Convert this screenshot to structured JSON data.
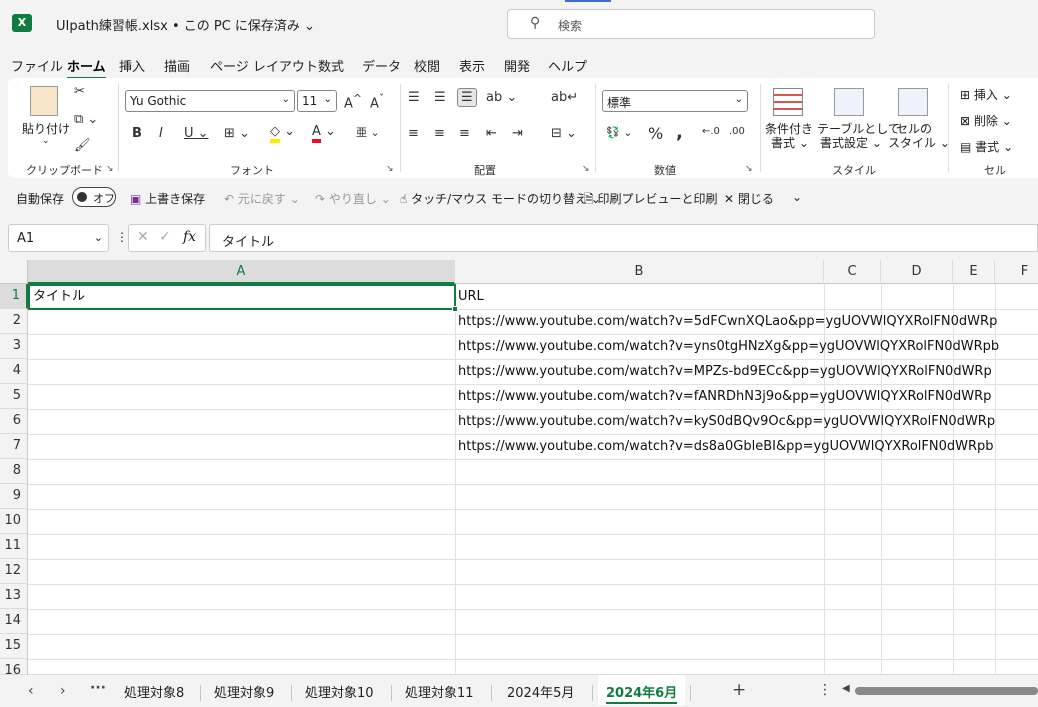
{
  "window": {
    "doc_title": "UIpath練習帳.xlsx • この PC に保存済み",
    "search_placeholder": "検索"
  },
  "menu": [
    "ファイル",
    "ホーム",
    "挿入",
    "描画",
    "ページ レイアウト",
    "数式",
    "データ",
    "校閲",
    "表示",
    "開発",
    "ヘルプ"
  ],
  "ribbon": {
    "clipboard": {
      "paste": "貼り付け",
      "label": "クリップボード"
    },
    "font": {
      "family": "Yu Gothic",
      "size": "11",
      "label": "フォント"
    },
    "alignment": {
      "label": "配置"
    },
    "number": {
      "format": "標準",
      "label": "数値"
    },
    "styles": {
      "conditional": "条件付き",
      "conditional2": "書式",
      "table": "テーブルとして",
      "table2": "書式設定",
      "cell": "セルの",
      "cell2": "スタイル",
      "label": "スタイル"
    },
    "cells": {
      "insert": "挿入",
      "delete": "削除",
      "format": "書式",
      "label": "セル"
    }
  },
  "qat": {
    "autosave": "自動保存",
    "autosave_state": "オフ",
    "save": "上書き保存",
    "undo": "元に戻す",
    "redo": "やり直し",
    "touch": "タッチ/マウス モードの切り替え",
    "print": "印刷プレビューと印刷",
    "close": "閉じる"
  },
  "formula_bar": {
    "name_box": "A1",
    "content": "タイトル"
  },
  "columns": [
    "A",
    "B",
    "C",
    "D",
    "E",
    "F"
  ],
  "rows": [
    "1",
    "2",
    "3",
    "4",
    "5",
    "6",
    "7",
    "8",
    "9",
    "10",
    "11",
    "12",
    "13",
    "14",
    "15",
    "16"
  ],
  "cells": {
    "A1": "タイトル",
    "B1": "URL",
    "B2": "https://www.youtube.com/watch?v=5dFCwnXQLao&pp=ygUOVWlQYXRolFN0dWRp",
    "B3": "https://www.youtube.com/watch?v=yns0tgHNzXg&pp=ygUOVWlQYXRolFN0dWRpb",
    "B4": "https://www.youtube.com/watch?v=MPZs-bd9ECc&pp=ygUOVWlQYXRolFN0dWRp",
    "B5": "https://www.youtube.com/watch?v=fANRDhN3j9o&pp=ygUOVWlQYXRolFN0dWRp",
    "B6": "https://www.youtube.com/watch?v=kyS0dBQv9Oc&pp=ygUOVWlQYXRolFN0dWRp",
    "B7": "https://www.youtube.com/watch?v=ds8a0GbleBI&pp=ygUOVWlQYXRolFN0dWRpb"
  },
  "sheets": [
    "処理対象8",
    "処理対象9",
    "処理対象10",
    "処理対象11",
    "2024年5月",
    "2024年6月"
  ],
  "active_sheet": "2024年6月",
  "colors": {
    "accent": "#107c41",
    "ribbon_bg": "#ffffff",
    "chrome_bg": "#f3f3f3"
  }
}
